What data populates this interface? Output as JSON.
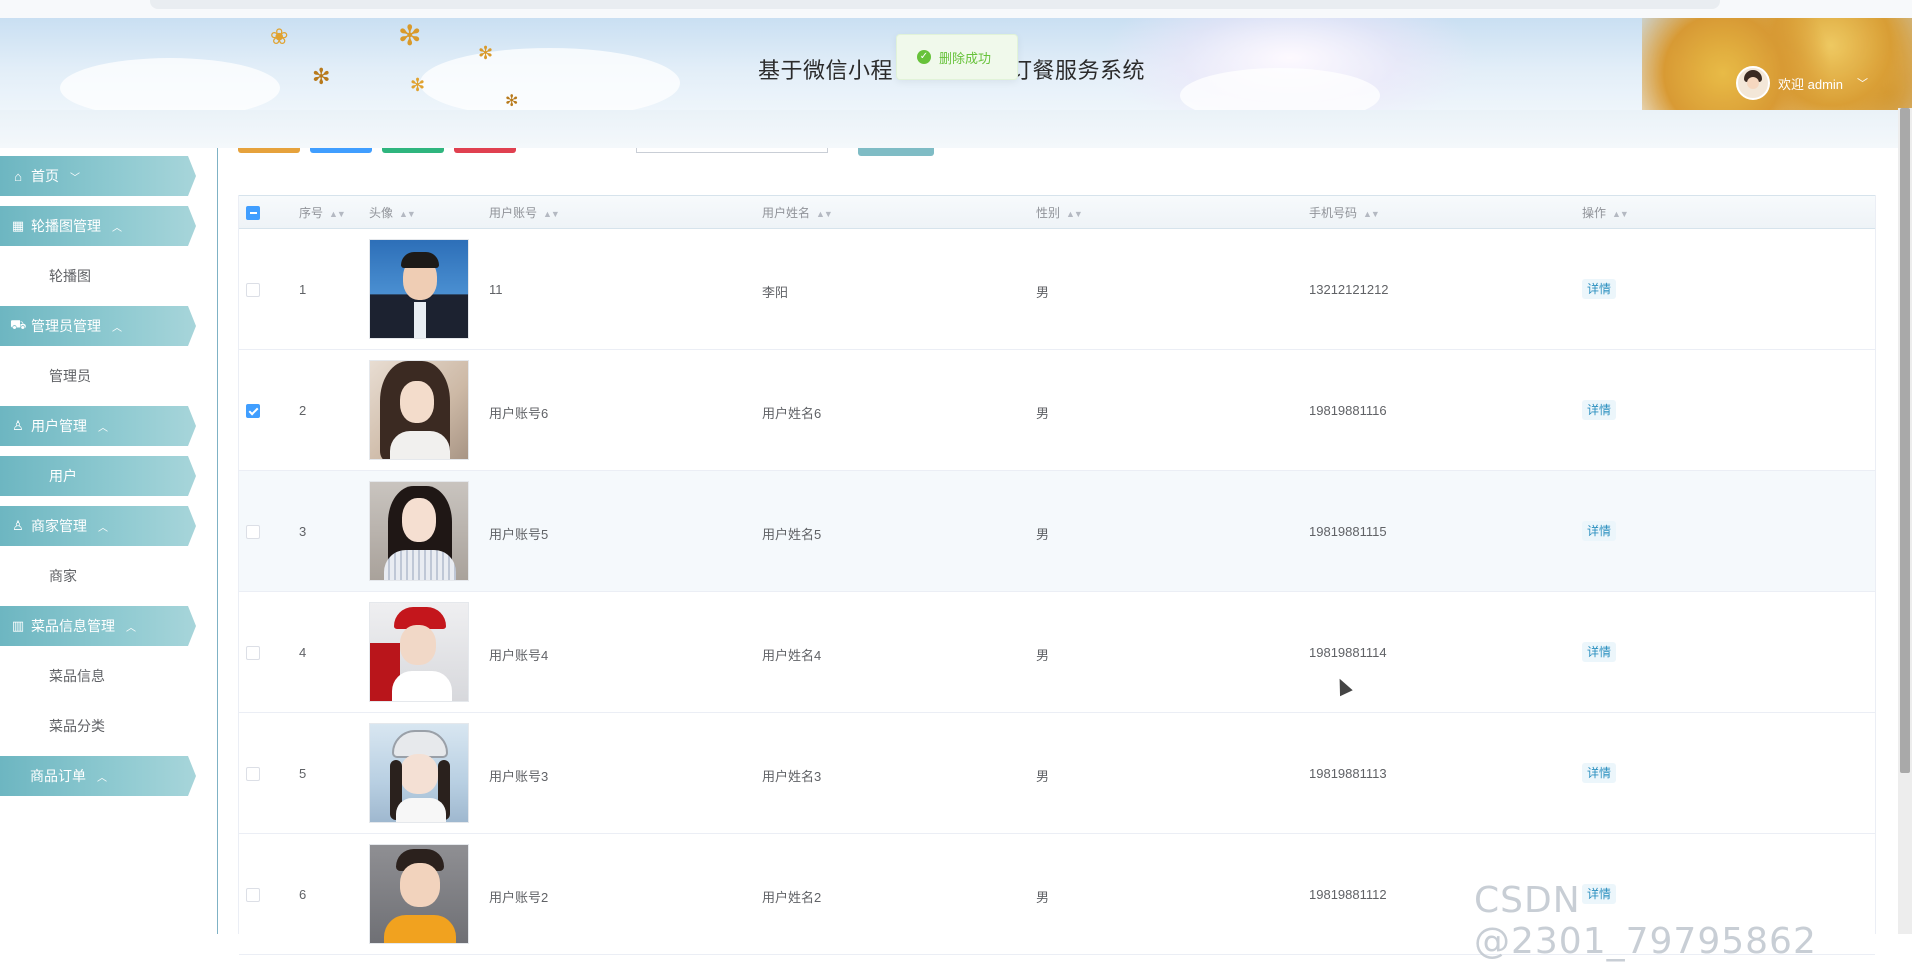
{
  "header": {
    "title_left": "基于微信小程",
    "title_right": "订餐服务系统",
    "welcome": "欢迎 admin"
  },
  "toast": {
    "message": "删除成功"
  },
  "sidebar": {
    "items": [
      {
        "label": "首页",
        "icon": "home-icon"
      },
      {
        "label": "轮播图管理",
        "icon": "grid-icon"
      },
      {
        "label": "轮播图"
      },
      {
        "label": "管理员管理",
        "icon": "car-icon"
      },
      {
        "label": "管理员"
      },
      {
        "label": "用户管理",
        "icon": "person-icon"
      },
      {
        "label": "用户"
      },
      {
        "label": "商家管理",
        "icon": "person-icon"
      },
      {
        "label": "商家"
      },
      {
        "label": "菜品信息管理",
        "icon": "chart-icon"
      },
      {
        "label": "菜品信息"
      },
      {
        "label": "菜品分类"
      },
      {
        "label": "商品订单"
      }
    ]
  },
  "toolbar": {
    "colors": [
      "#e6a23c",
      "#409eff",
      "#2fb57e",
      "#e04050",
      "#7fbcc5"
    ]
  },
  "table": {
    "headers": [
      "序号",
      "头像",
      "用户账号",
      "用户姓名",
      "性别",
      "手机号码",
      "操作"
    ],
    "rows": [
      {
        "no": "1",
        "account": "11",
        "name": "李阳",
        "gender": "男",
        "phone": "13212121212",
        "action": "详情",
        "checked": false
      },
      {
        "no": "2",
        "account": "用户账号6",
        "name": "用户姓名6",
        "gender": "男",
        "phone": "19819881116",
        "action": "详情",
        "checked": true
      },
      {
        "no": "3",
        "account": "用户账号5",
        "name": "用户姓名5",
        "gender": "男",
        "phone": "19819881115",
        "action": "详情",
        "checked": false
      },
      {
        "no": "4",
        "account": "用户账号4",
        "name": "用户姓名4",
        "gender": "男",
        "phone": "19819881114",
        "action": "详情",
        "checked": false
      },
      {
        "no": "5",
        "account": "用户账号3",
        "name": "用户姓名3",
        "gender": "男",
        "phone": "19819881113",
        "action": "详情",
        "checked": false
      },
      {
        "no": "6",
        "account": "用户账号2",
        "name": "用户姓名2",
        "gender": "男",
        "phone": "19819881112",
        "action": "详情",
        "checked": false
      }
    ]
  },
  "watermark": "CSDN @2301_79795862"
}
